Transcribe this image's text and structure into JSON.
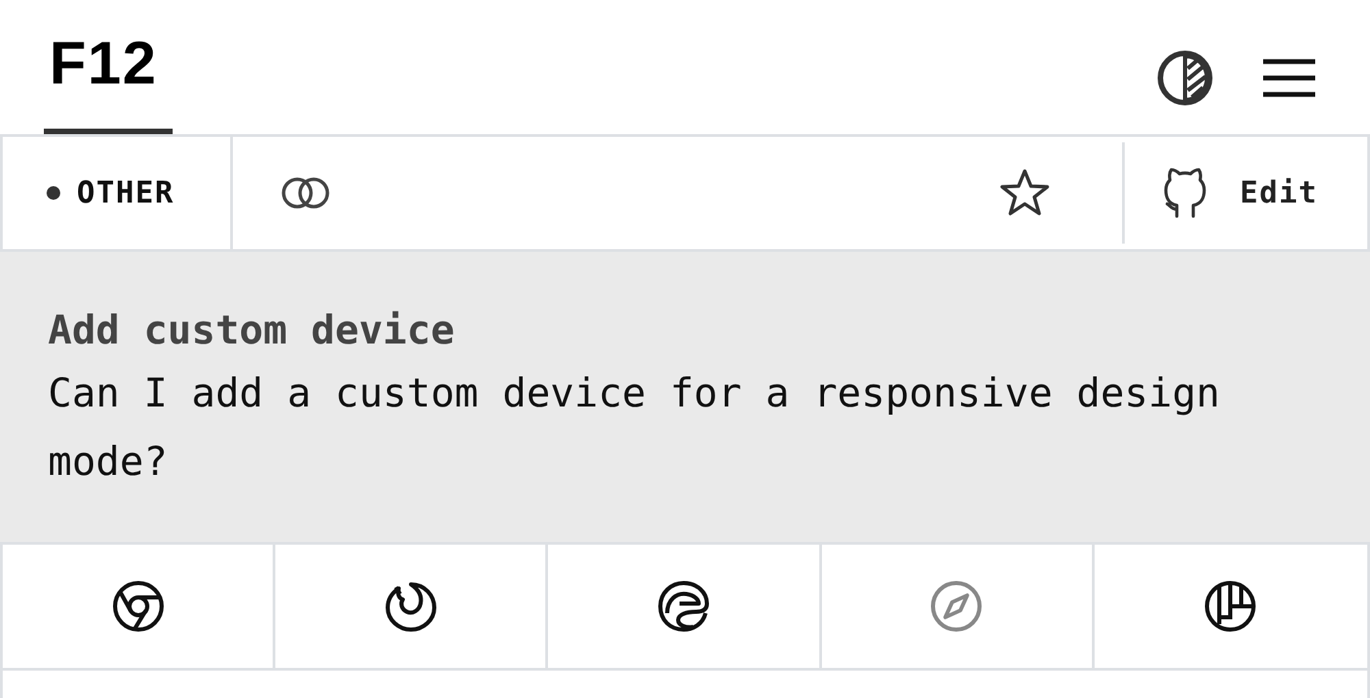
{
  "header": {
    "logo": "F12",
    "logo_selected": true
  },
  "toolbar": {
    "category": "OTHER",
    "starred": false,
    "edit": "Edit"
  },
  "question": {
    "title": "Add custom device",
    "text": "Can I add a custom device for a responsive design mode?"
  },
  "browsers": [
    {
      "kind": "chrome",
      "supported": true
    },
    {
      "kind": "firefox",
      "supported": true
    },
    {
      "kind": "edge",
      "supported": true
    },
    {
      "kind": "safari",
      "supported": false
    },
    {
      "kind": "polypane",
      "supported": true
    }
  ]
}
